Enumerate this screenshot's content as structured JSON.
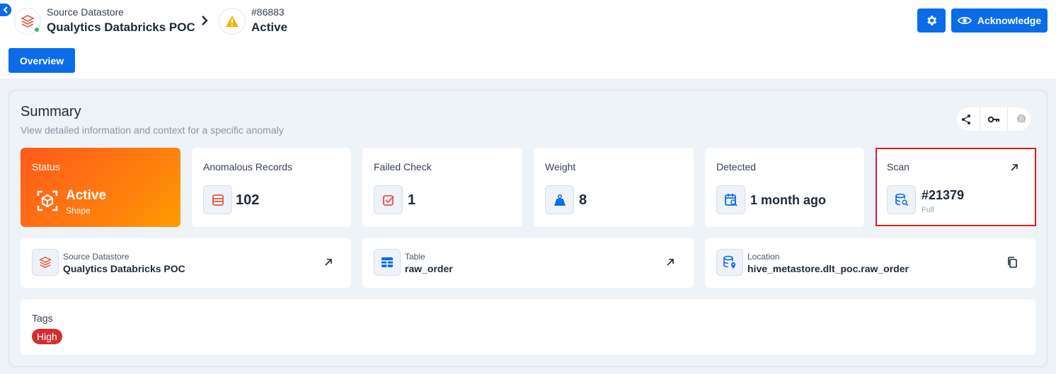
{
  "header": {
    "datastore_label": "Source Datastore",
    "datastore_name": "Qualytics Databricks POC",
    "anomaly_id": "#86883",
    "anomaly_status": "Active",
    "acknowledge_label": "Acknowledge"
  },
  "tabs": [
    {
      "label": "Overview"
    }
  ],
  "summary": {
    "title": "Summary",
    "subtitle": "View detailed information and context for a specific anomaly"
  },
  "cards": {
    "status": {
      "label": "Status",
      "value": "Active",
      "sub": "Shape"
    },
    "anomalous_records": {
      "label": "Anomalous Records",
      "value": "102"
    },
    "failed_check": {
      "label": "Failed Check",
      "value": "1"
    },
    "weight": {
      "label": "Weight",
      "value": "8"
    },
    "detected": {
      "label": "Detected",
      "value": "1 month ago"
    },
    "scan": {
      "label": "Scan",
      "value": "#21379",
      "sub": "Full"
    }
  },
  "info": {
    "datastore": {
      "label": "Source Datastore",
      "value": "Qualytics Databricks POC"
    },
    "table": {
      "label": "Table",
      "value": "raw_order"
    },
    "location": {
      "label": "Location",
      "value": "hive_metastore.dlt_poc.raw_order"
    }
  },
  "tags": {
    "label": "Tags",
    "items": [
      "High"
    ]
  },
  "colors": {
    "primary": "#0a6ce8",
    "status_gradient_start": "#ff5a1a",
    "status_gradient_end": "#ff9c00",
    "tag_high": "#d32f2f",
    "highlight": "#e11d1d"
  }
}
